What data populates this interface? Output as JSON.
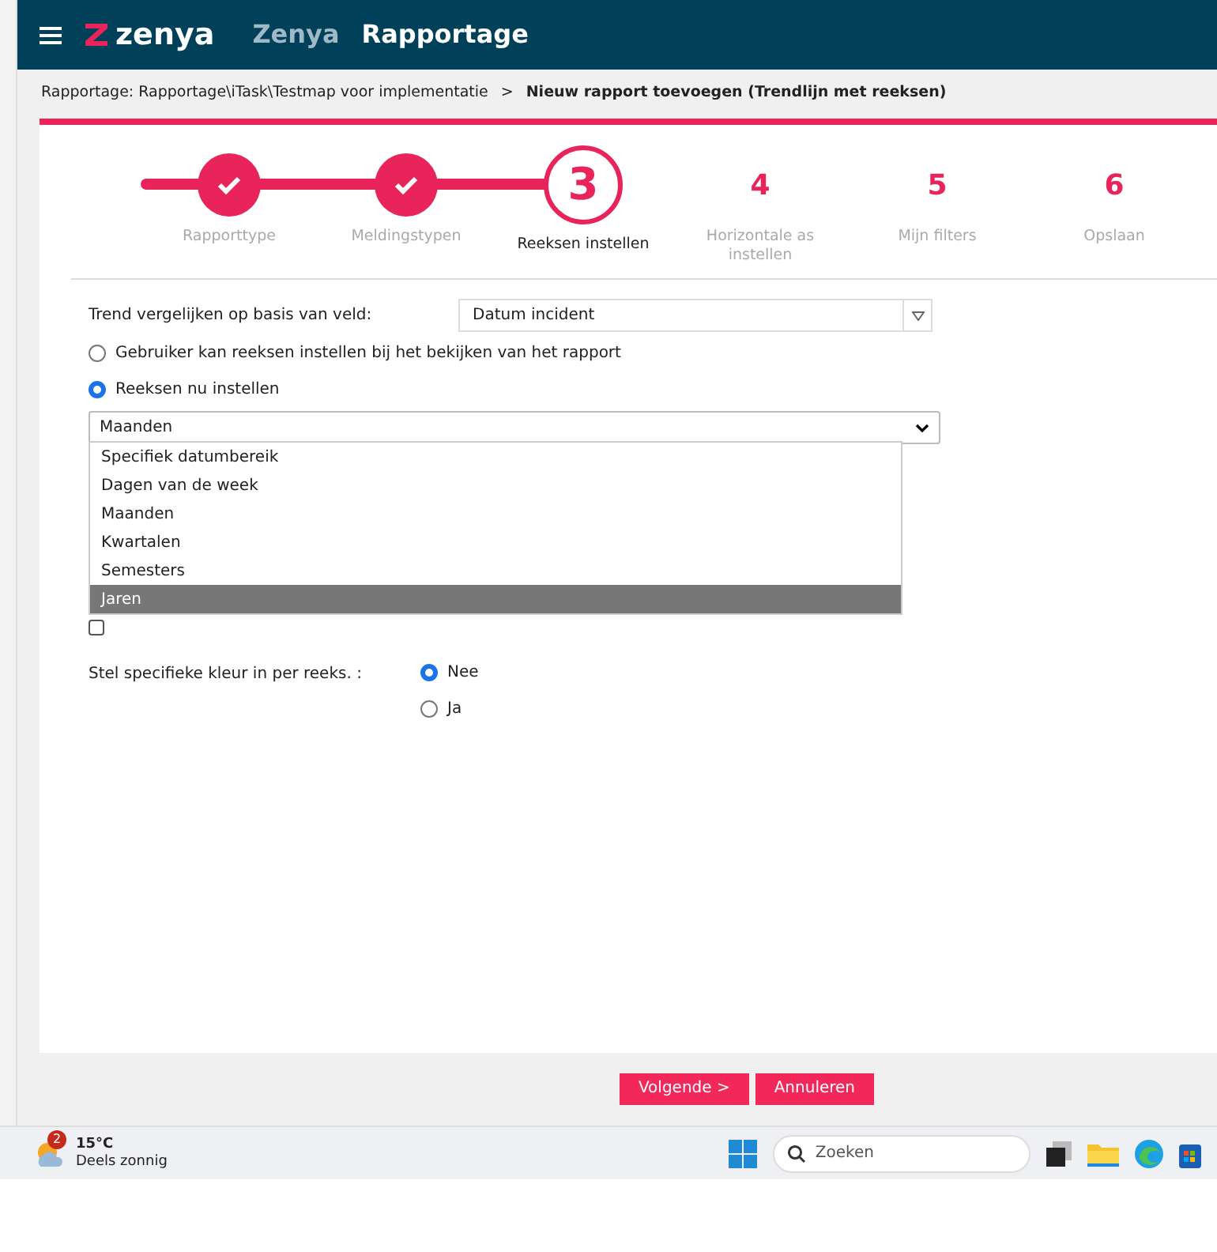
{
  "app_bar": {
    "logo": "zenya",
    "app_name": "Zenya",
    "module": "Rapportage"
  },
  "breadcrumb": {
    "path": "Rapportage: Rapportage\\iTask\\Testmap voor implementatie",
    "separator": ">",
    "current": "Nieuw rapport toevoegen (Trendlijn met reeksen)"
  },
  "steps": [
    {
      "completed": true,
      "selected": false,
      "label": "Rapporttype"
    },
    {
      "completed": true,
      "selected": false,
      "label": "Meldingstypen"
    },
    {
      "completed": false,
      "selected": true,
      "number": "3",
      "label": "Reeksen instellen"
    },
    {
      "completed": false,
      "selected": false,
      "number": "4",
      "label": "Horizontale as instellen"
    },
    {
      "completed": false,
      "selected": false,
      "number": "5",
      "label": "Mijn filters"
    },
    {
      "completed": false,
      "selected": false,
      "number": "6",
      "label": "Opslaan"
    }
  ],
  "form": {
    "trend_label": "Trend vergelijken op basis van veld:",
    "trend_value": "Datum incident",
    "series_mode": [
      {
        "label": "Gebruiker kan reeksen instellen bij het bekijken van het rapport",
        "selected": false
      },
      {
        "label": "Reeksen nu instellen",
        "selected": true
      }
    ],
    "series_select": {
      "value": "Maanden",
      "expanded": true,
      "options": [
        {
          "label": "Specifiek datumbereik",
          "highlighted": false
        },
        {
          "label": "Dagen van de week",
          "highlighted": false
        },
        {
          "label": "Maanden",
          "highlighted": false
        },
        {
          "label": "Kwartalen",
          "highlighted": false
        },
        {
          "label": "Semesters",
          "highlighted": false
        },
        {
          "label": "Jaren",
          "highlighted": true
        }
      ]
    },
    "include_empty": {
      "checked": false
    },
    "color_label": "Stel specifieke kleur in per reeks. :",
    "color_options": [
      {
        "label": "Nee",
        "selected": true
      },
      {
        "label": "Ja",
        "selected": false
      }
    ]
  },
  "buttons": [
    "Volgende >",
    "Annuleren"
  ],
  "taskbar": {
    "weather": {
      "badge": "2",
      "temperature": "15°C",
      "condition": "Deels zonnig"
    },
    "search": {
      "placeholder": "Zoeken"
    }
  }
}
